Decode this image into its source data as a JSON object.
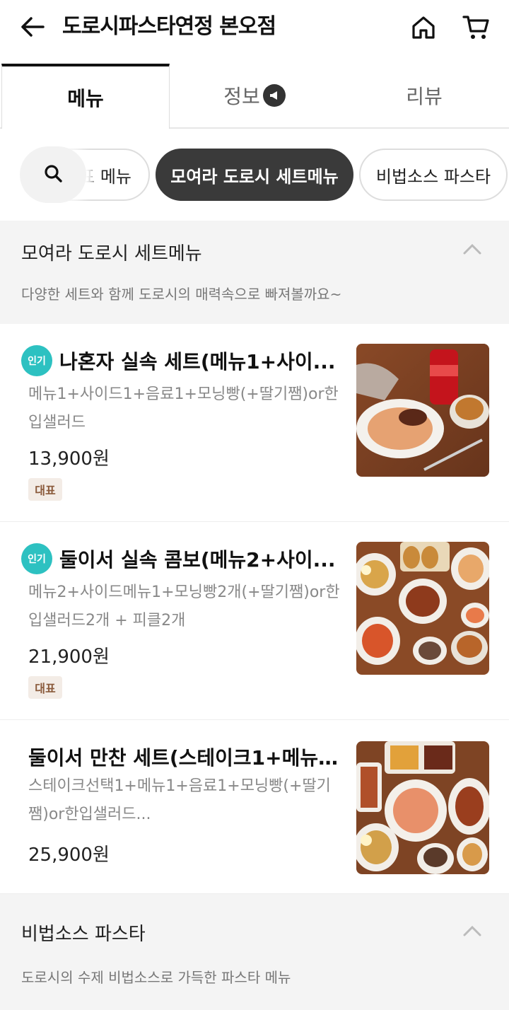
{
  "header": {
    "title": "도로시파스타연정 본오점"
  },
  "tabs": [
    {
      "label": "메뉴",
      "active": true
    },
    {
      "label": "정보",
      "active": false
    },
    {
      "label": "리뷰",
      "active": false
    }
  ],
  "chips": [
    "표 메뉴",
    "모여라 도로시 세트메뉴",
    "비법소스 파스타"
  ],
  "sections": [
    {
      "title": "모여라 도로시 세트메뉴",
      "description": "다양한 세트와 함께 도로시의 매력속으로 빠져볼까요~"
    },
    {
      "title": "비법소스 파스타",
      "description": "도로시의 수제 비법소스로 가득한 파스타 메뉴"
    }
  ],
  "items": [
    {
      "popular_badge": "인기",
      "name": "나혼자 실속 세트(메뉴1+사이...",
      "desc_line1": "메뉴1+사이드1+음료1+모닝빵(+딸기쨈)or한",
      "desc_line2": "입샐러드",
      "price": "13,900원",
      "rep_tag": "대표"
    },
    {
      "popular_badge": "인기",
      "name": "둘이서 실속 콤보(메뉴2+사이...",
      "desc_line1": "메뉴2+사이드메뉴1+모닝빵2개(+딸기쨈)or한",
      "desc_line2": "입샐러드2개 + 피클2개",
      "price": "21,900원",
      "rep_tag": "대표"
    },
    {
      "name": "둘이서 만찬 세트(스테이크1+메뉴...",
      "desc_line1": "스테이크선택1+메뉴1+음료1+모닝빵(+딸기",
      "desc_line2": "쨈)or한입샐러드...",
      "price": "25,900원"
    }
  ],
  "colors": {
    "popular_badge": "#2dc1c1",
    "active_chip": "#3a3a3a",
    "section_bg": "#f4f4f4",
    "rep_tag_bg": "#f3ece6",
    "rep_tag_text": "#8a5a3b"
  }
}
